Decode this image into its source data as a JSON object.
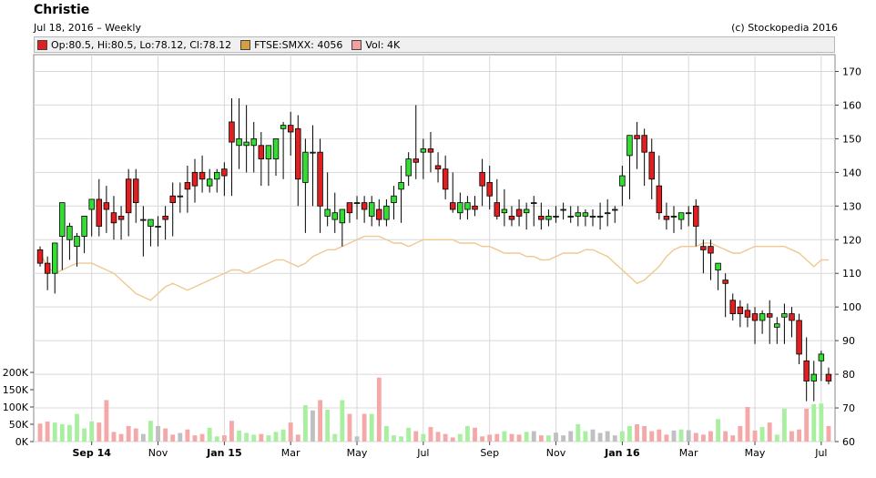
{
  "header": {
    "title": "Christie",
    "subtitle": "Jul 18, 2016 – Weekly",
    "copyright": "(c) Stockopedia 2016"
  },
  "legend": [
    {
      "label": "Op:80.5, Hi:80.5, Lo:78.12, Cl:78.12",
      "color": "#e02020"
    },
    {
      "label": "FTSE:SMXX: 4056",
      "color": "#d4a040"
    },
    {
      "label": "Vol: 4K",
      "color": "#f4a0a0"
    }
  ],
  "colors": {
    "up": "#33dd33",
    "down": "#e02020",
    "index_line": "#f0c890",
    "vol_up": "#a8f0a0",
    "vol_down": "#f4a8a8",
    "vol_flat": "#c0c0c0",
    "grid": "#d8d8d8"
  },
  "chart_data": {
    "type": "candlestick",
    "x_axis_labels": [
      "Sep 14",
      "Nov",
      "Jan 15",
      "Mar",
      "May",
      "Jul",
      "Sep",
      "Nov",
      "Jan 16",
      "Mar",
      "May",
      "Jul"
    ],
    "x_axis_label_bold": [
      true,
      false,
      true,
      false,
      false,
      false,
      false,
      false,
      true,
      false,
      false,
      false
    ],
    "x_axis_label_week_index": [
      7,
      16,
      25,
      34,
      43,
      52,
      61,
      70,
      79,
      88,
      97,
      106
    ],
    "price_axis": {
      "min": 60,
      "max": 175,
      "ticks": [
        60,
        70,
        80,
        90,
        100,
        110,
        120,
        130,
        140,
        150,
        160,
        170
      ]
    },
    "volume_axis": {
      "min": 0,
      "max": 250000,
      "ticks": [
        0,
        50000,
        100000,
        150000,
        200000
      ],
      "tick_labels": [
        "0K",
        "50K",
        "100K",
        "150K",
        "200K"
      ]
    },
    "open": [
      117,
      113,
      110,
      121,
      120,
      118,
      121,
      129,
      132,
      131,
      128,
      127,
      138,
      138,
      126,
      124,
      124,
      127,
      133,
      133,
      137,
      140,
      140,
      136,
      138,
      141,
      155,
      148,
      148,
      148,
      148,
      144,
      144,
      153,
      154,
      153,
      137,
      146,
      146,
      127,
      126,
      125,
      131,
      131,
      131,
      127,
      129,
      126,
      131,
      135,
      139,
      144,
      146,
      147,
      142,
      141,
      131,
      128,
      129,
      130,
      140,
      137,
      131,
      128,
      127,
      129,
      128,
      131,
      127,
      126,
      127,
      129,
      127,
      127,
      127,
      127,
      127,
      128,
      129,
      136,
      145,
      151,
      151,
      146,
      136,
      127,
      127,
      126,
      128,
      130,
      118,
      118,
      111,
      108,
      102,
      100,
      99,
      98,
      96,
      98,
      94,
      97,
      98,
      96,
      84,
      78,
      84,
      80
    ],
    "high": [
      118,
      115,
      113,
      123,
      125,
      122,
      125,
      132,
      138,
      136,
      133,
      130,
      141,
      141,
      130,
      126,
      127,
      130,
      137,
      137,
      142,
      144,
      145,
      141,
      141,
      143,
      162,
      162,
      160,
      155,
      152,
      148,
      149,
      155,
      158,
      157,
      150,
      154,
      150,
      140,
      134,
      128,
      131,
      133,
      133,
      133,
      132,
      132,
      136,
      142,
      146,
      160,
      150,
      152,
      146,
      145,
      140,
      134,
      133,
      133,
      144,
      142,
      138,
      135,
      130,
      132,
      131,
      133,
      131,
      129,
      130,
      131,
      130,
      130,
      129,
      129,
      131,
      132,
      130,
      142,
      148,
      155,
      153,
      150,
      145,
      131,
      130,
      128,
      130,
      132,
      120,
      120,
      113,
      110,
      104,
      102,
      101,
      100,
      99,
      102,
      97,
      101,
      100,
      98,
      91,
      84,
      87,
      82
    ],
    "low": [
      112,
      105,
      104,
      111,
      114,
      112,
      116,
      121,
      121,
      122,
      120,
      120,
      121,
      125,
      115,
      118,
      118,
      120,
      121,
      128,
      128,
      131,
      134,
      134,
      134,
      133,
      133,
      141,
      140,
      140,
      136,
      136,
      139,
      138,
      145,
      130,
      122,
      130,
      122,
      124,
      122,
      118,
      125,
      126,
      125,
      124,
      124,
      124,
      126,
      125,
      136,
      138,
      138,
      140,
      137,
      132,
      128,
      126,
      126,
      127,
      130,
      129,
      126,
      124,
      124,
      124,
      123,
      124,
      123,
      124,
      125,
      126,
      125,
      124,
      124,
      124,
      123,
      124,
      125,
      130,
      132,
      141,
      136,
      132,
      126,
      123,
      122,
      123,
      124,
      118,
      110,
      108,
      105,
      97,
      96,
      94,
      94,
      89,
      92,
      89,
      89,
      89,
      91,
      83,
      72,
      72,
      78,
      77
    ],
    "close": [
      113,
      110,
      119,
      131,
      124,
      121,
      127,
      132,
      124,
      129,
      125,
      126,
      128,
      131,
      126,
      126,
      124,
      126,
      131,
      133,
      135,
      136,
      138,
      138,
      140,
      139,
      149,
      150,
      149,
      150,
      144,
      148,
      150,
      154,
      152,
      138,
      146,
      146,
      130,
      129,
      128,
      129,
      128,
      131,
      129,
      131,
      126,
      130,
      133,
      137,
      144,
      143,
      147,
      146,
      141,
      135,
      129,
      131,
      131,
      129,
      136,
      133,
      127,
      129,
      126,
      127,
      129,
      131,
      126,
      127,
      127,
      129,
      127,
      128,
      128,
      127,
      127,
      128,
      129,
      139,
      151,
      150,
      146,
      138,
      128,
      126,
      127,
      128,
      128,
      124,
      117,
      116,
      113,
      107,
      98,
      98,
      97,
      96,
      98,
      97,
      95,
      98,
      96,
      86,
      78,
      80,
      86,
      78
    ],
    "volume": [
      52000,
      58000,
      55000,
      50000,
      48000,
      80000,
      38000,
      58000,
      55000,
      120000,
      28000,
      22000,
      45000,
      38000,
      22000,
      60000,
      45000,
      38000,
      20000,
      25000,
      35000,
      18000,
      22000,
      40000,
      15000,
      18000,
      60000,
      32000,
      25000,
      20000,
      22000,
      18000,
      28000,
      35000,
      55000,
      20000,
      105000,
      90000,
      120000,
      92000,
      22000,
      120000,
      80000,
      15000,
      80000,
      80000,
      185000,
      45000,
      18000,
      15000,
      40000,
      30000,
      22000,
      42000,
      28000,
      22000,
      12000,
      22000,
      45000,
      40000,
      15000,
      20000,
      22000,
      30000,
      22000,
      20000,
      28000,
      30000,
      18000,
      18000,
      26000,
      18000,
      30000,
      50000,
      30000,
      35000,
      25000,
      30000,
      18000,
      30000,
      45000,
      50000,
      45000,
      30000,
      35000,
      20000,
      32000,
      35000,
      33000,
      25000,
      20000,
      30000,
      65000,
      30000,
      18000,
      45000,
      100000,
      32000,
      42000,
      55000,
      20000,
      95000,
      30000,
      35000,
      95000,
      108000,
      110000,
      45000
    ]
  }
}
